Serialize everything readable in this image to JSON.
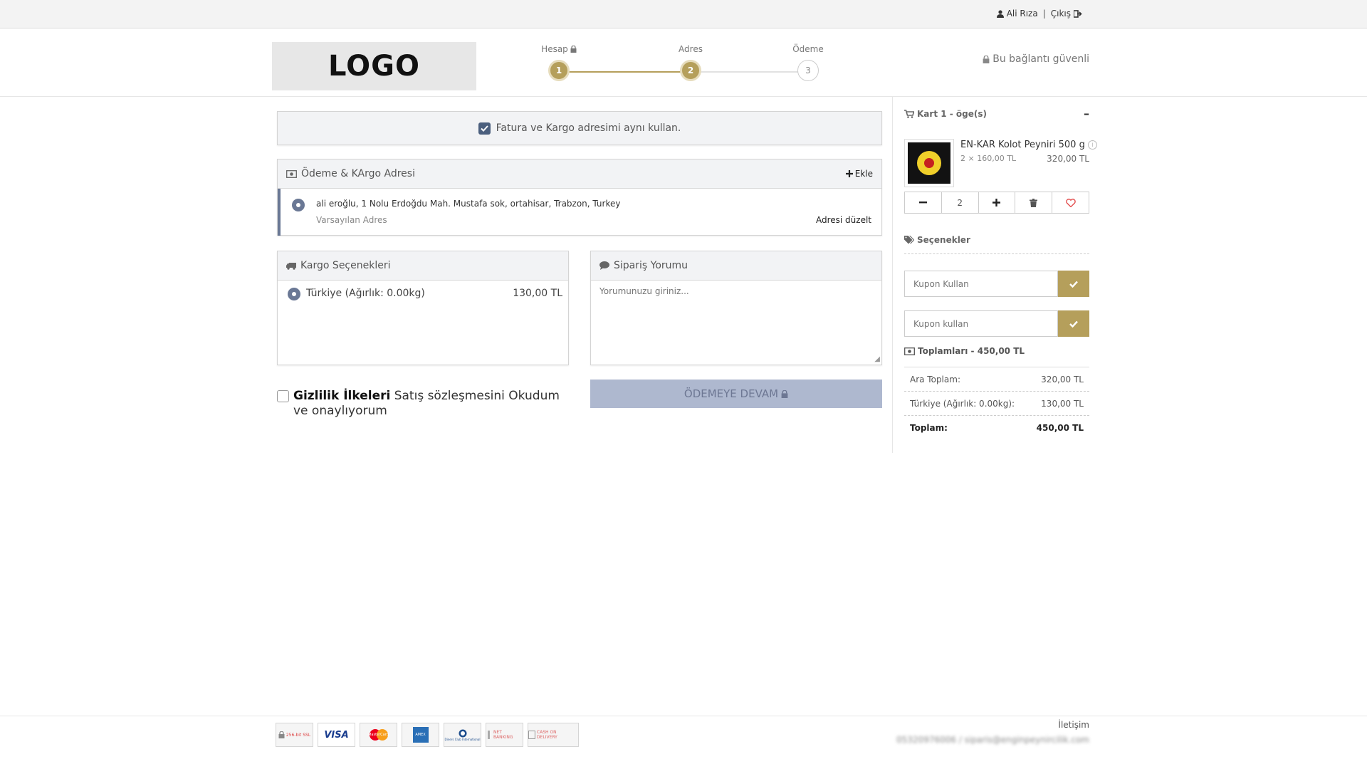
{
  "topbar": {
    "user_name": "Ali Rıza",
    "separator": "|",
    "logout": "Çıkış"
  },
  "header": {
    "logo": "LOGO",
    "steps": [
      {
        "label": "Hesap",
        "number": "1",
        "state": "done"
      },
      {
        "label": "Adres",
        "number": "2",
        "state": "done"
      },
      {
        "label": "Ödeme",
        "number": "3",
        "state": "todo"
      }
    ],
    "secure_text": "Bu bağlantı güvenli"
  },
  "main": {
    "same_address_label": "Fatura ve Kargo adresimi aynı kullan.",
    "address_panel": {
      "title": "Ödeme & KArgo Adresi",
      "add_label": "Ekle",
      "address_line": "ali eroğlu, 1 Nolu Erdoğdu Mah. Mustafa sok, ortahisar, Trabzon, Turkey",
      "default_label": "Varsayılan Adres",
      "edit_label": "Adresi düzelt"
    },
    "cargo_panel": {
      "title": "Kargo Seçenekleri",
      "option_name": "Türkiye (Ağırlık: 0.00kg)",
      "option_price": "130,00 TL"
    },
    "comment_panel": {
      "title": "Sipariş Yorumu",
      "placeholder": "Yorumunuzu giriniz..."
    },
    "terms": {
      "bold": "Gizlilik İlkeleri",
      "text": " Satış sözleşmesini Okudum ve onaylıyorum"
    },
    "pay_button": "ÖDEMEYE DEVAM"
  },
  "cart": {
    "title": "Kart 1 - öge(s)",
    "collapse_symbol": "–",
    "item": {
      "name": "EN-KAR Kolot Peyniri 500 g",
      "qty_price": "2 × 160,00 TL",
      "total": "320,00 TL",
      "quantity": "2"
    },
    "options_label": "Seçenekler",
    "coupon1_placeholder": "Kupon Kullan",
    "coupon2_placeholder": "Kupon kullan",
    "totals_title": "Toplamları - 450,00 TL",
    "totals": [
      {
        "label": "Ara Toplam:",
        "value": "320,00 TL"
      },
      {
        "label": "Türkiye (Ağırlık: 0.00kg):",
        "value": "130,00 TL"
      },
      {
        "label": "Toplam:",
        "value": "450,00 TL"
      }
    ]
  },
  "footer": {
    "badges": [
      "256-bit SSL",
      "VISA",
      "MasterCard",
      "AMEX",
      "Diners Club International",
      "NET BANKING",
      "CASH ON DELIVERY"
    ],
    "contact_label": "İletişim",
    "contact_value": "05320976006 / siparis@enginpeynircilik.com"
  },
  "colors": {
    "accent": "#b59f5b",
    "primary_dark": "#4b5f7e",
    "button_disabled": "#aeb8cf"
  }
}
